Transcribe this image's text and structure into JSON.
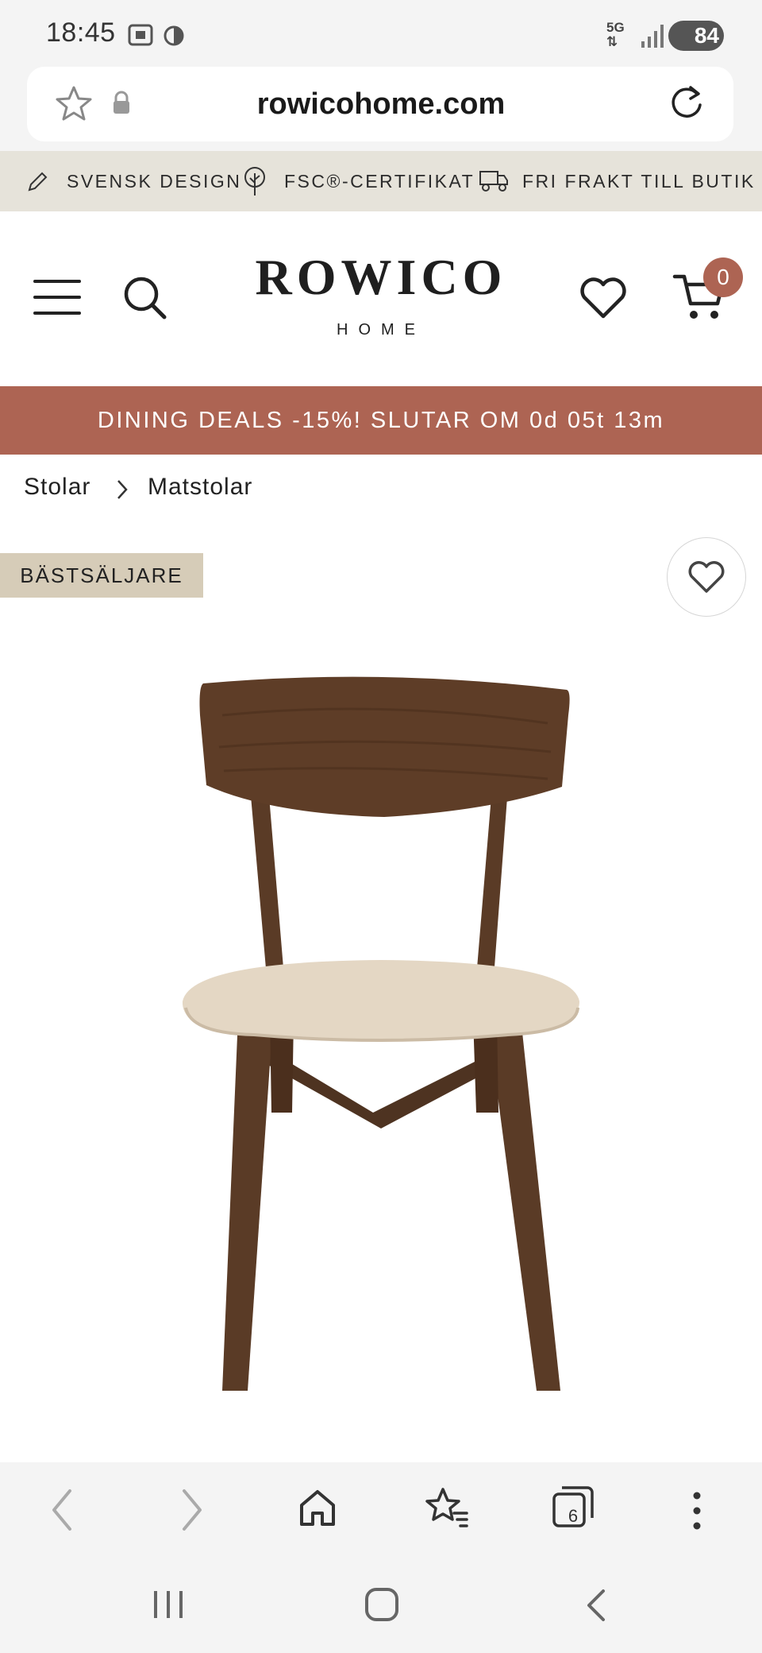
{
  "status_bar": {
    "time": "18:45",
    "network": "5G",
    "battery": "84"
  },
  "browser": {
    "url": "rowicohome.com",
    "tab_count": "6"
  },
  "usp": {
    "item1": "SVENSK DESIGN",
    "item2": "FSC®-CERTIFIKAT",
    "item3": "FRI FRAKT TILL BUTIK"
  },
  "header": {
    "logo": "ROWICO",
    "logo_sub": "HOME",
    "cart_count": "0"
  },
  "promo": {
    "text": "DINING DEALS -15%! SLUTAR OM 0d 05t 13m"
  },
  "breadcrumb": {
    "level1": "Stolar",
    "level2": "Matstolar"
  },
  "product": {
    "badge": "BÄSTSÄLJARE"
  },
  "colors": {
    "accent": "#ad6453",
    "usp_bg": "#e6e3da",
    "badge_bg": "#d6ccb8",
    "chrome_bg": "#f4f4f4"
  },
  "icons": [
    "star-icon",
    "lock-icon",
    "reload-icon",
    "pencil-icon",
    "tree-icon",
    "truck-icon",
    "menu-icon",
    "search-icon",
    "heart-icon",
    "cart-icon",
    "back-icon",
    "forward-icon",
    "home-icon",
    "bookmarks-icon",
    "tabs-icon",
    "more-icon",
    "recents-icon",
    "system-home-icon",
    "system-back-icon"
  ]
}
